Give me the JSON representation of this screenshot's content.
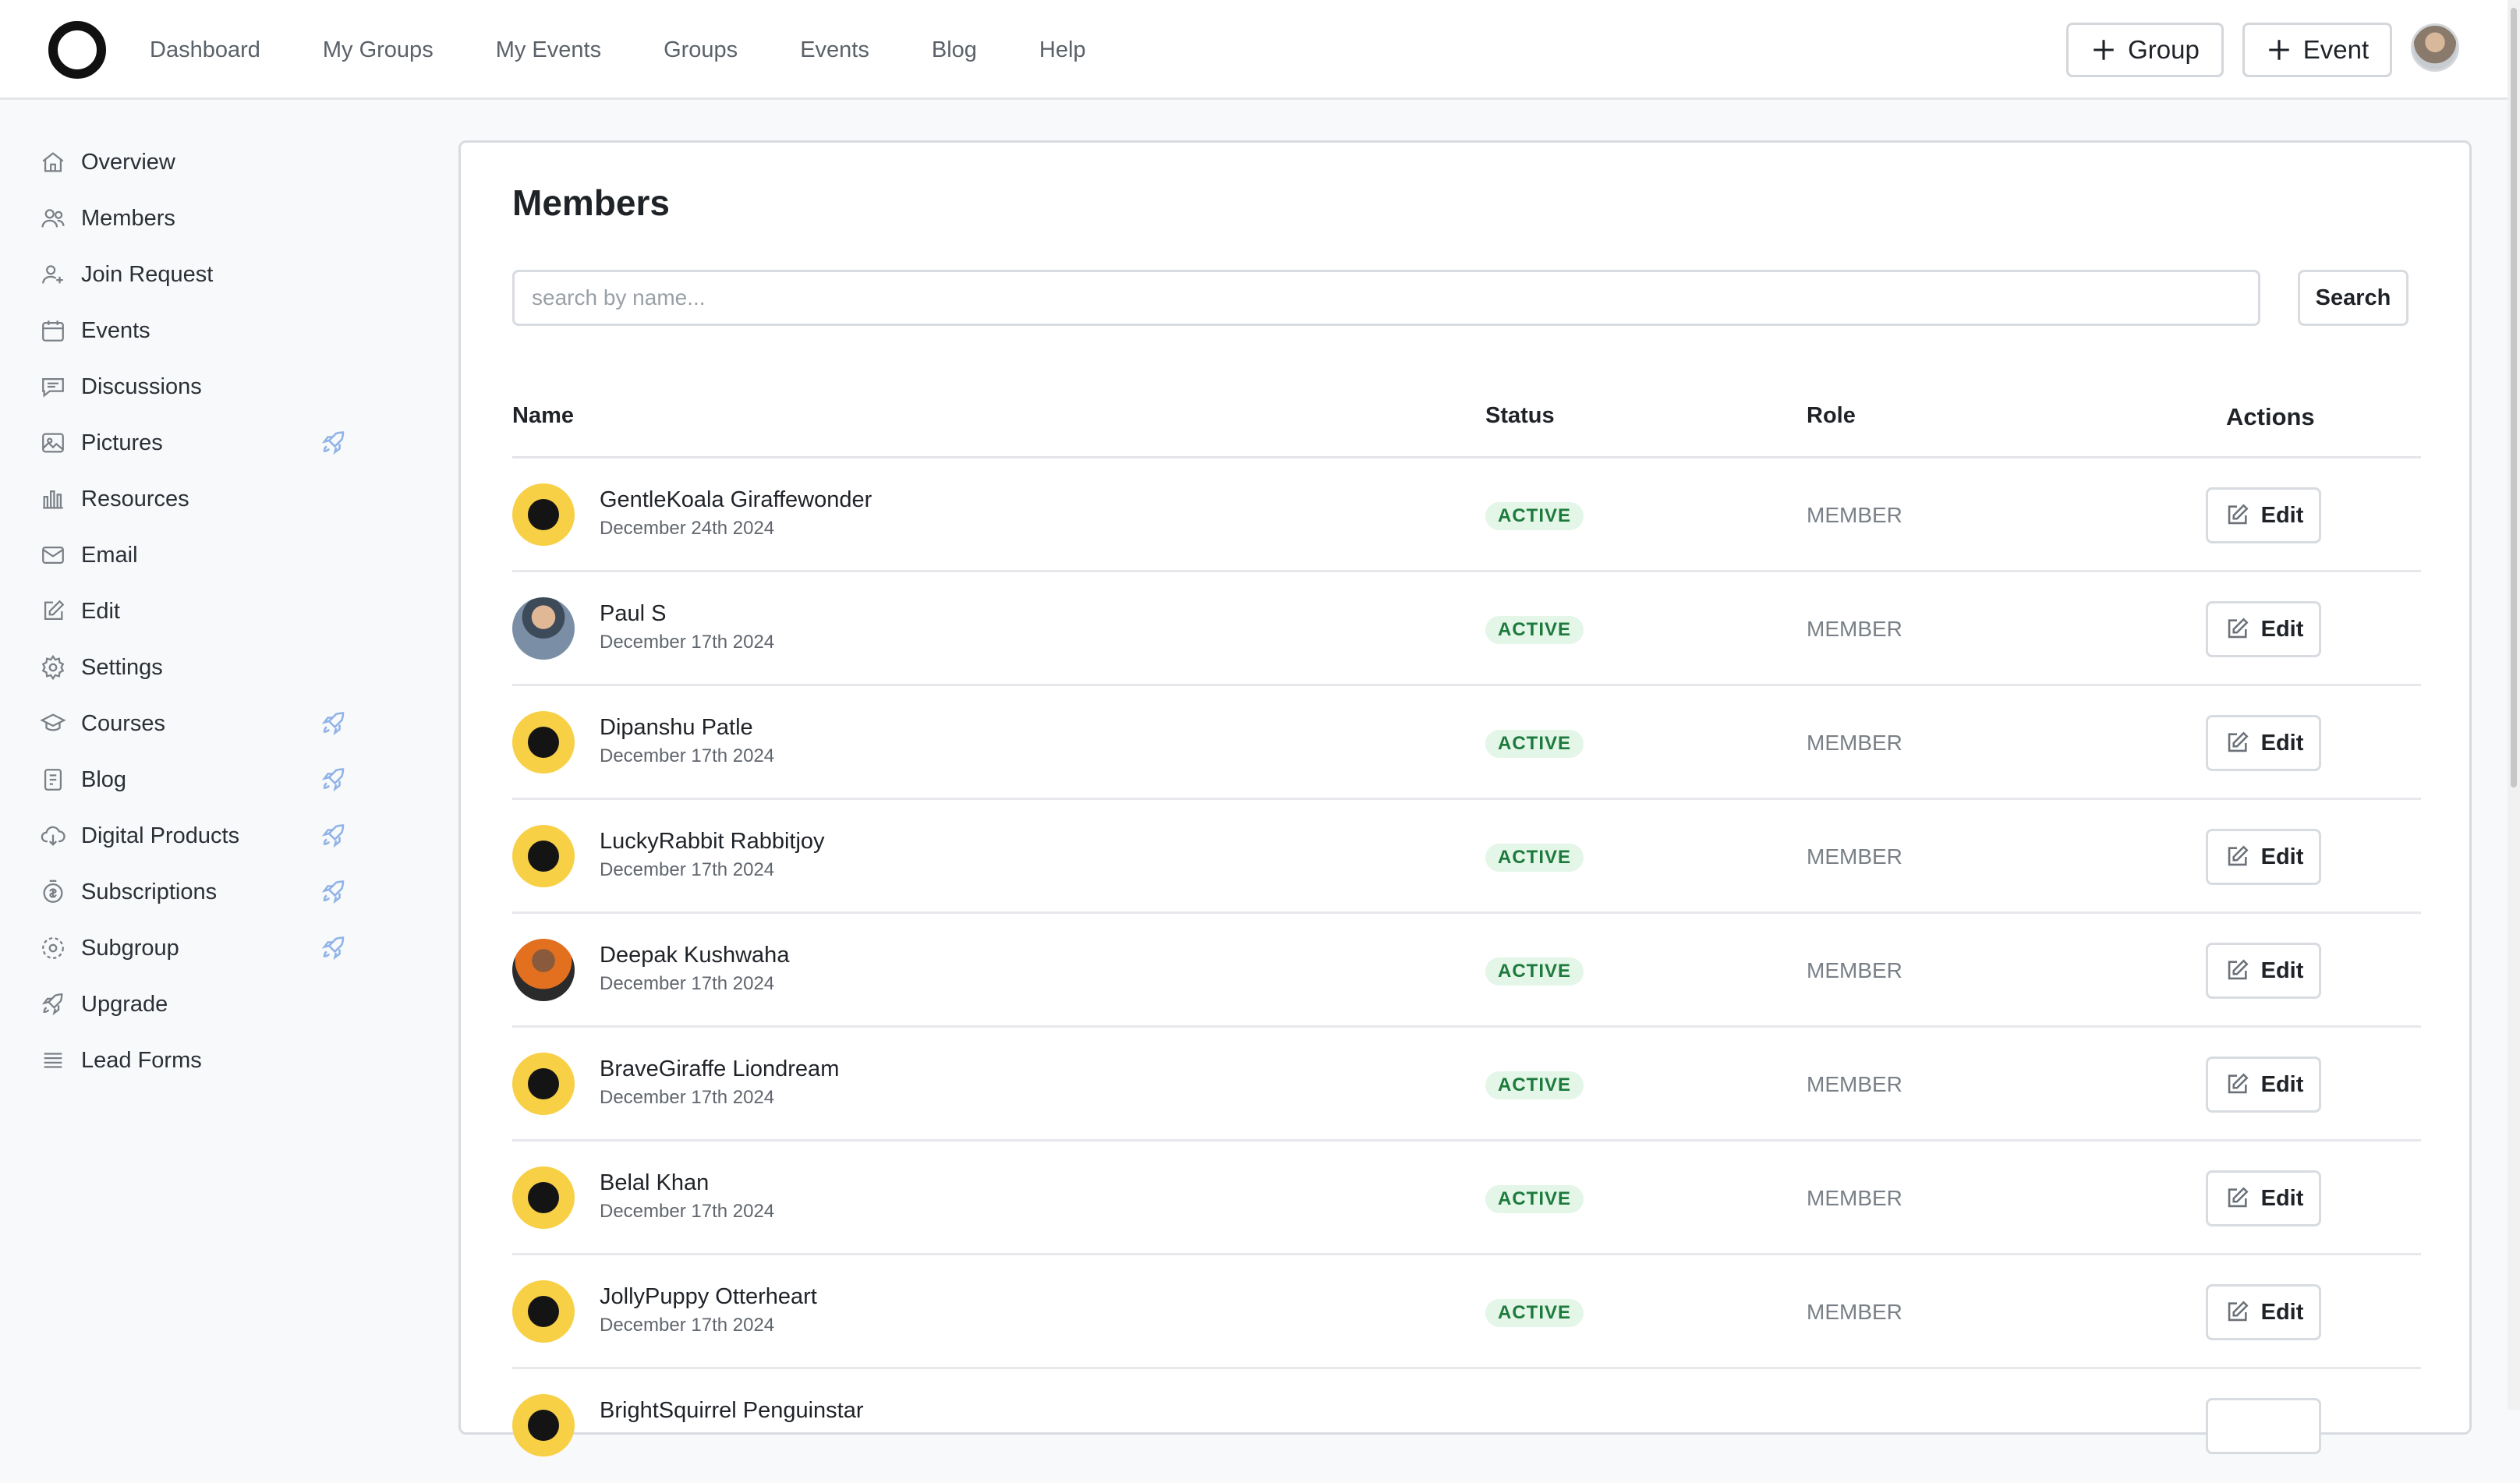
{
  "nav": {
    "links": [
      "Dashboard",
      "My Groups",
      "My Events",
      "Groups",
      "Events",
      "Blog",
      "Help"
    ],
    "group_button": "Group",
    "event_button": "Event"
  },
  "sidebar": {
    "items": [
      {
        "label": "Overview",
        "icon": "home-icon",
        "pro": false
      },
      {
        "label": "Members",
        "icon": "users-icon",
        "pro": false
      },
      {
        "label": "Join Request",
        "icon": "user-plus-icon",
        "pro": false
      },
      {
        "label": "Events",
        "icon": "calendar-icon",
        "pro": false
      },
      {
        "label": "Discussions",
        "icon": "chat-icon",
        "pro": false
      },
      {
        "label": "Pictures",
        "icon": "image-icon",
        "pro": true
      },
      {
        "label": "Resources",
        "icon": "library-icon",
        "pro": false
      },
      {
        "label": "Email",
        "icon": "mail-icon",
        "pro": false
      },
      {
        "label": "Edit",
        "icon": "edit-icon",
        "pro": false
      },
      {
        "label": "Settings",
        "icon": "gear-icon",
        "pro": false
      },
      {
        "label": "Courses",
        "icon": "graduation-cap-icon",
        "pro": true
      },
      {
        "label": "Blog",
        "icon": "blog-icon",
        "pro": true
      },
      {
        "label": "Digital Products",
        "icon": "download-cloud-icon",
        "pro": true
      },
      {
        "label": "Subscriptions",
        "icon": "subscription-icon",
        "pro": true
      },
      {
        "label": "Subgroup",
        "icon": "subgroup-icon",
        "pro": true
      },
      {
        "label": "Upgrade",
        "icon": "rocket-icon",
        "pro": false
      },
      {
        "label": "Lead Forms",
        "icon": "list-icon",
        "pro": false
      }
    ]
  },
  "main": {
    "title": "Members",
    "search": {
      "placeholder": "search by name...",
      "value": "",
      "button": "Search"
    },
    "table": {
      "headers": {
        "name": "Name",
        "status": "Status",
        "role": "Role",
        "actions": "Actions"
      },
      "rows": [
        {
          "name": "GentleKoala Giraffewonder",
          "date": "December 24th 2024",
          "status": "ACTIVE",
          "role": "MEMBER",
          "action": "Edit",
          "avatar": "default"
        },
        {
          "name": "Paul S",
          "date": "December 17th 2024",
          "status": "ACTIVE",
          "role": "MEMBER",
          "action": "Edit",
          "avatar": "photo"
        },
        {
          "name": "Dipanshu Patle",
          "date": "December 17th 2024",
          "status": "ACTIVE",
          "role": "MEMBER",
          "action": "Edit",
          "avatar": "default"
        },
        {
          "name": "LuckyRabbit Rabbitjoy",
          "date": "December 17th 2024",
          "status": "ACTIVE",
          "role": "MEMBER",
          "action": "Edit",
          "avatar": "default"
        },
        {
          "name": "Deepak Kushwaha",
          "date": "December 17th 2024",
          "status": "ACTIVE",
          "role": "MEMBER",
          "action": "Edit",
          "avatar": "photo"
        },
        {
          "name": "BraveGiraffe Liondream",
          "date": "December 17th 2024",
          "status": "ACTIVE",
          "role": "MEMBER",
          "action": "Edit",
          "avatar": "default"
        },
        {
          "name": "Belal Khan",
          "date": "December 17th 2024",
          "status": "ACTIVE",
          "role": "MEMBER",
          "action": "Edit",
          "avatar": "default"
        },
        {
          "name": "JollyPuppy Otterheart",
          "date": "December 17th 2024",
          "status": "ACTIVE",
          "role": "MEMBER",
          "action": "Edit",
          "avatar": "default"
        },
        {
          "name": "BrightSquirrel Penguinstar",
          "date": "",
          "status": "",
          "role": "",
          "action": "",
          "avatar": "default"
        }
      ]
    }
  },
  "colors": {
    "accent_yellow": "#f7d046",
    "active_bg": "#e3f6e8",
    "active_text": "#1e7a3c"
  }
}
